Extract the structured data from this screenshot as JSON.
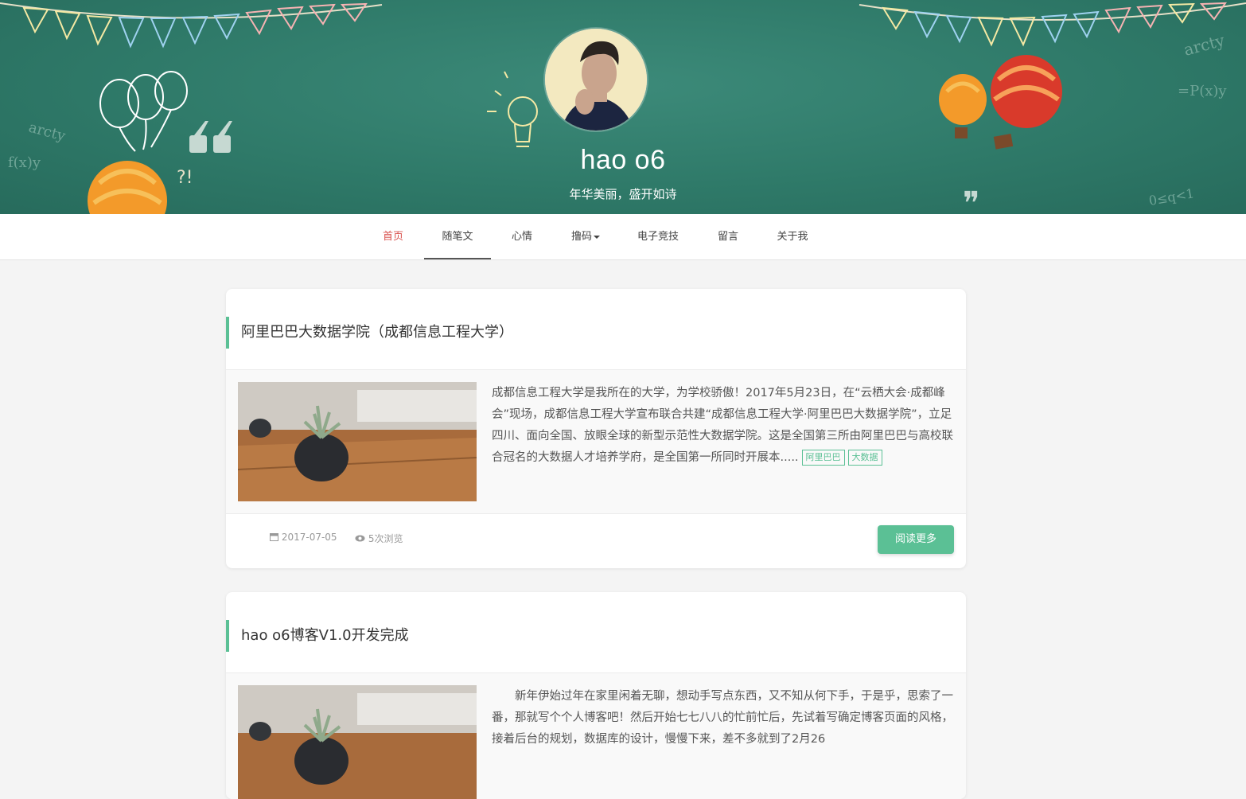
{
  "site": {
    "title": "hao o6",
    "subtitle": "年华美丽，盛开如诗"
  },
  "nav": {
    "items": [
      {
        "label": "首页"
      },
      {
        "label": "随笔文"
      },
      {
        "label": "心情"
      },
      {
        "label": "撸码"
      },
      {
        "label": "电子竞技"
      },
      {
        "label": "留言"
      },
      {
        "label": "关于我"
      }
    ]
  },
  "posts": [
    {
      "title": "阿里巴巴大数据学院（成都信息工程大学）",
      "excerpt": "成都信息工程大学是我所在的大学，为学校骄傲！2017年5月23日，在“云栖大会·成都峰会”现场，成都信息工程大学宣布联合共建“成都信息工程大学·阿里巴巴大数据学院”，立足四川、面向全国、放眼全球的新型示范性大数据学院。这是全国第三所由阿里巴巴与高校联合冠名的大数据人才培养学府，是全国第一所同时开展本.....",
      "tags": [
        "阿里巴巴",
        "大数据"
      ],
      "date": "2017-07-05",
      "views": "5次浏览",
      "read_more": "阅读更多"
    },
    {
      "title": "hao o6博客V1.0开发完成",
      "excerpt": "新年伊始过年在家里闲着无聊，想动手写点东西，又不知从何下手，于是乎，思索了一番，那就写个个人博客吧！然后开始七七八八的忙前忙后，先试着写确定博客页面的风格，接着后台的规划，数据库的设计，慢慢下来，差不多就到了2月26"
    }
  ],
  "colors": {
    "accent": "#5bc095",
    "nav_active_home": "#d9534f",
    "chalkboard": "#2f7a69"
  }
}
